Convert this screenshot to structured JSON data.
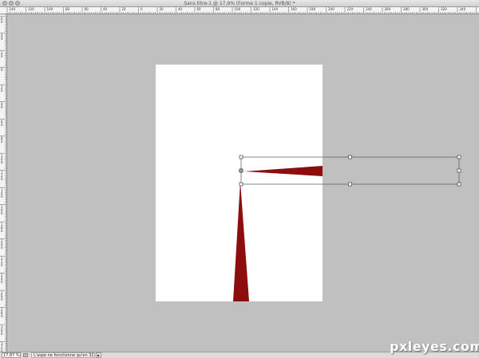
{
  "window": {
    "title": "Sans titre-1 @ 17,9% (Forme 1 copie, RVB/8) *"
  },
  "rulers": {
    "horizontal_labels": [
      "140",
      "120",
      "100",
      "80",
      "60",
      "40",
      "20",
      "0",
      "20",
      "40",
      "60",
      "80",
      "100",
      "120",
      "140",
      "160",
      "180",
      "200",
      "220",
      "240",
      "260",
      "280",
      "300",
      "320",
      "340"
    ],
    "vertical_labels": [
      "60",
      "40",
      "20",
      "0",
      "20",
      "40",
      "60",
      "80",
      "100",
      "120",
      "140",
      "160",
      "180",
      "200",
      "220",
      "240",
      "260",
      "280",
      "300",
      "320"
    ]
  },
  "document": {
    "shape_color": "#8b0d0d",
    "background": "#ffffff"
  },
  "statusbar": {
    "zoom": "17,87 %",
    "message": "L'aspe ne fonctionne qu'en 32 bits"
  },
  "watermark": {
    "text": "pxleyes.com"
  }
}
